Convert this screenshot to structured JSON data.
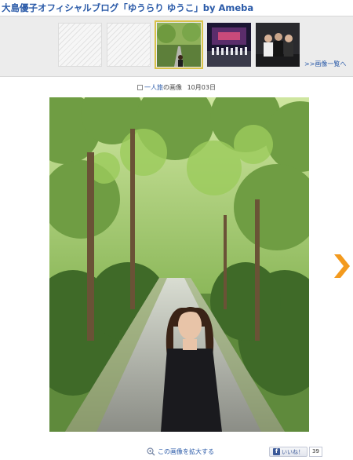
{
  "header": {
    "title": "大島優子オフィシャルブログ「ゆうらり ゆうこ」by Ameba"
  },
  "thumbnails": {
    "items": [
      {
        "kind": "blank"
      },
      {
        "kind": "blank"
      },
      {
        "kind": "forest-path",
        "active": true
      },
      {
        "kind": "stage"
      },
      {
        "kind": "group-photo"
      }
    ],
    "more_link": ">>画像一覧へ"
  },
  "caption": {
    "theme_link": "一人旅",
    "suffix": "の画像",
    "date": "10月03日"
  },
  "viewer": {
    "next_icon": "chevron-right-icon",
    "accent_color": "#f39a1e"
  },
  "footer": {
    "zoom_label": "この画像を拡大する",
    "like_label": "いいね！",
    "like_count": "39"
  }
}
